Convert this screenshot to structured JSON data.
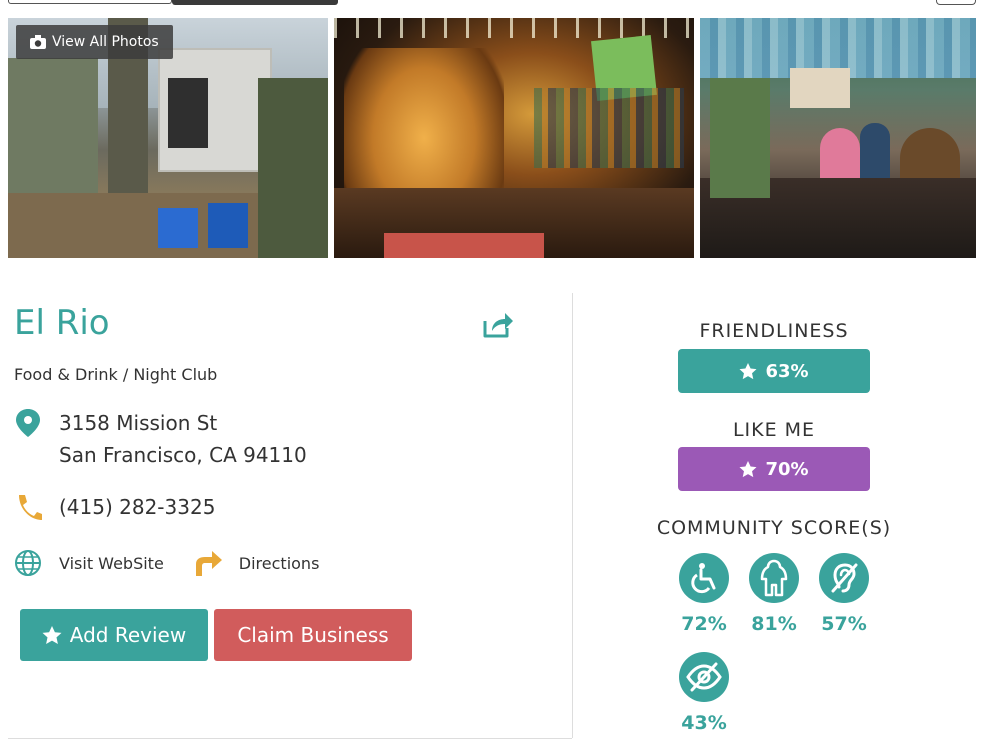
{
  "photos": {
    "view_all_label": "View All Photos"
  },
  "business": {
    "name": "El Rio",
    "category": "Food & Drink / Night Club",
    "address_line1": "3158 Mission St",
    "address_line2": "San Francisco, CA 94110",
    "phone": "(415) 282-3325",
    "website_label": "Visit WebSite",
    "directions_label": "Directions"
  },
  "actions": {
    "add_review_label": "Add Review",
    "claim_label": "Claim Business"
  },
  "ratings": {
    "friendliness_heading": "FRIENDLINESS",
    "friendliness_value": "63%",
    "friendliness_color": "#3aa39c",
    "likeme_heading": "LIKE ME",
    "likeme_value": "70%",
    "likeme_color": "#9b59b6",
    "community_heading": "COMMUNITY SCORE(S)",
    "community": [
      {
        "icon": "wheelchair-icon",
        "value": "72%"
      },
      {
        "icon": "body-icon",
        "value": "81%"
      },
      {
        "icon": "deaf-icon",
        "value": "57%"
      },
      {
        "icon": "blind-icon",
        "value": "43%"
      }
    ]
  }
}
